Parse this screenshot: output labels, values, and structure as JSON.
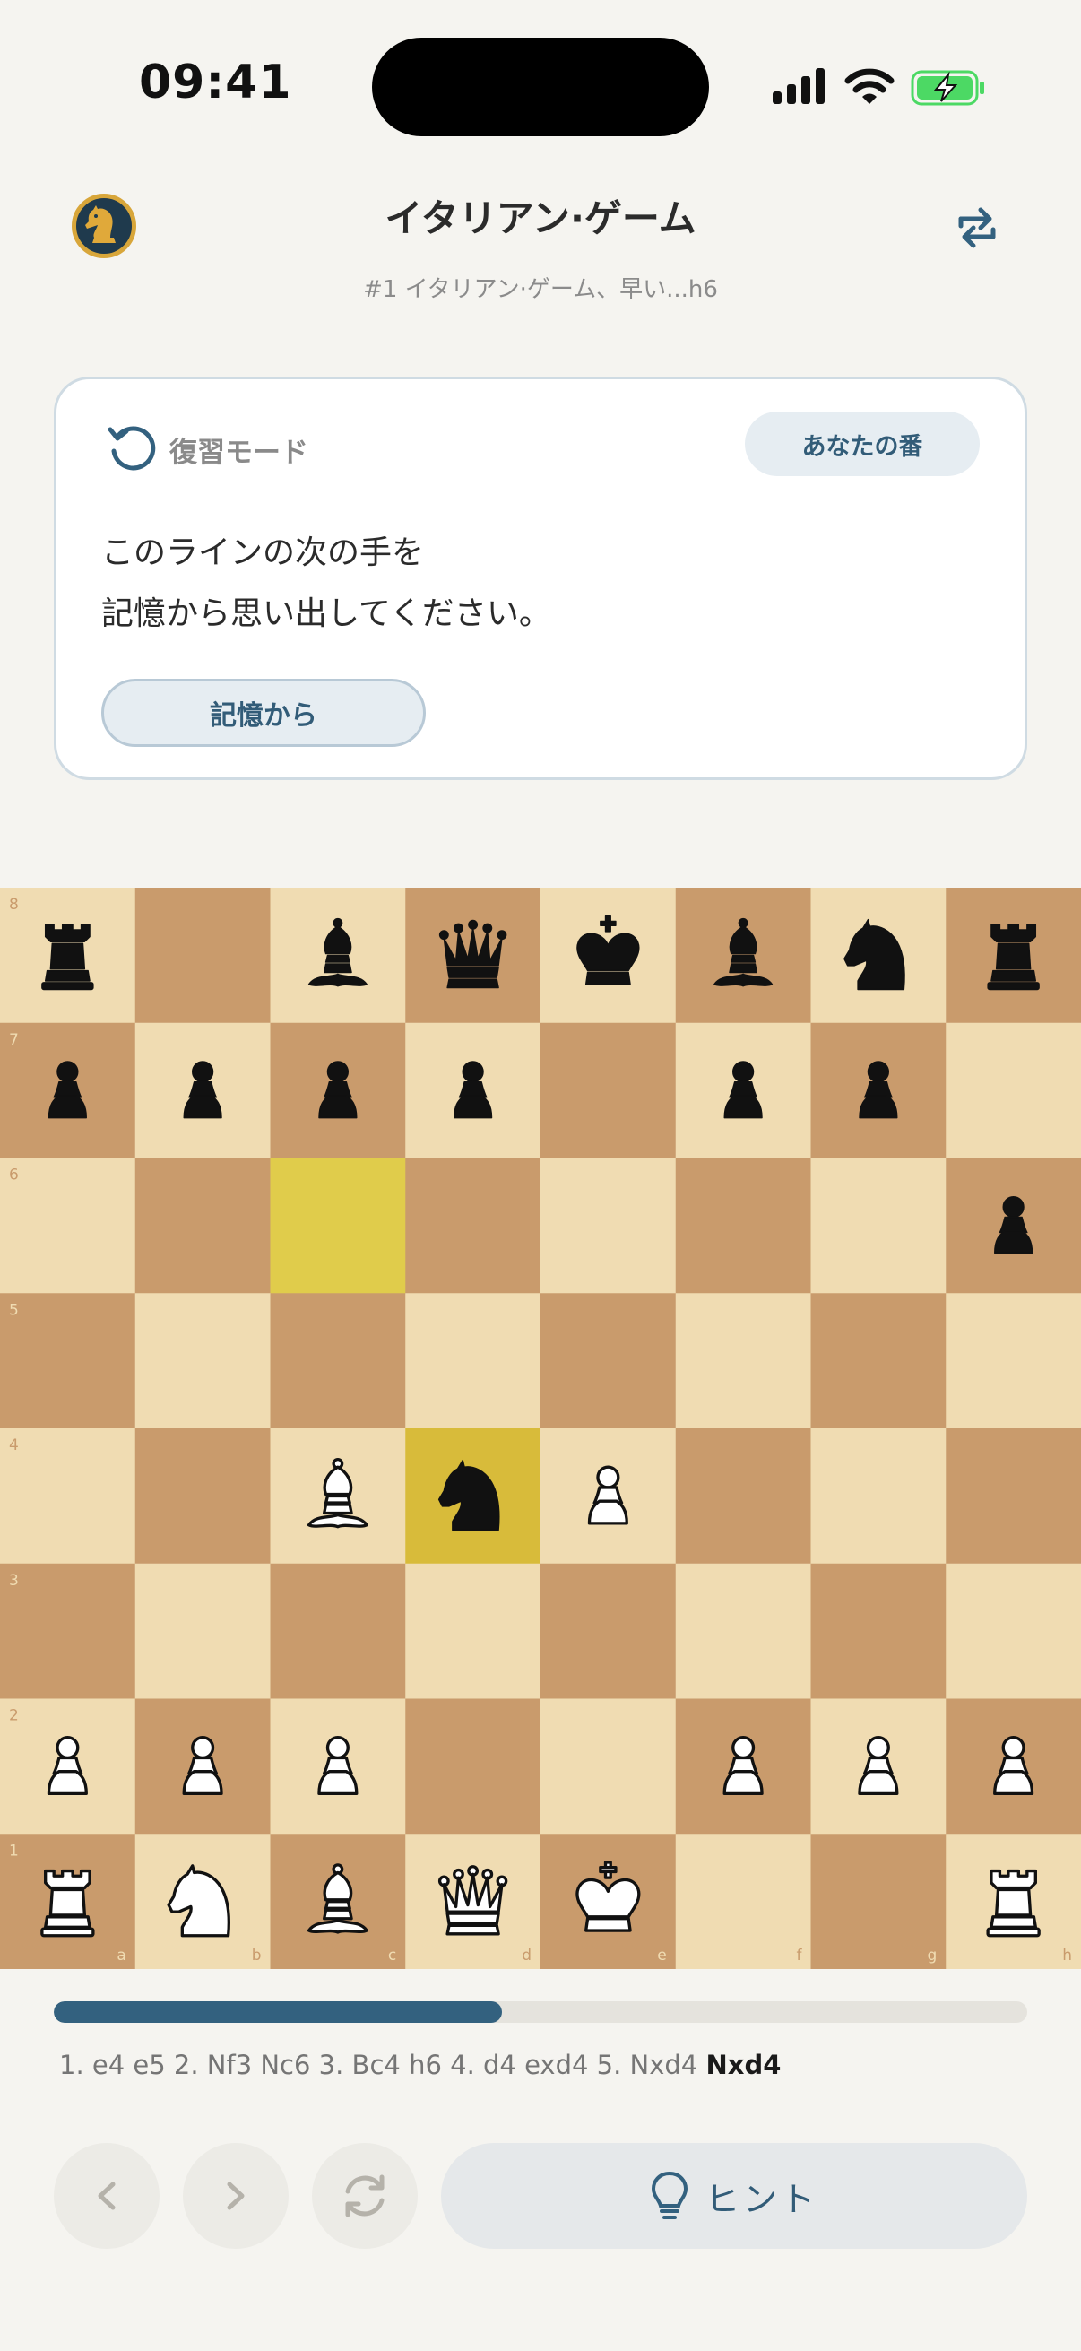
{
  "status_bar": {
    "time": "09:41"
  },
  "header": {
    "title": "イタリアン·ゲーム",
    "subtitle": "#1 イタリアン·ゲーム、早い...h6",
    "logo_icon": "knight-logo-icon",
    "flip_icon": "flip-board-icon"
  },
  "review_card": {
    "mode_label": "復習モード",
    "mode_icon": "undo-circle-icon",
    "turn_badge": "あなたの番",
    "prompt_line1": "このラインの次の手を",
    "prompt_line2": "記憶から思い出してください。",
    "memory_button": "記憶から"
  },
  "board": {
    "orientation": "white",
    "light_color": "#f0dcb2",
    "dark_color": "#c99b6c",
    "highlight_light": "#e0cc4b",
    "highlight_dark": "#d8bb3a",
    "highlights": [
      "c6",
      "d4"
    ],
    "ranks": [
      "8",
      "7",
      "6",
      "5",
      "4",
      "3",
      "2",
      "1"
    ],
    "files": [
      "a",
      "b",
      "c",
      "d",
      "e",
      "f",
      "g",
      "h"
    ],
    "pieces": [
      {
        "sq": "a8",
        "p": "r"
      },
      {
        "sq": "c8",
        "p": "b"
      },
      {
        "sq": "d8",
        "p": "q"
      },
      {
        "sq": "e8",
        "p": "k"
      },
      {
        "sq": "f8",
        "p": "b"
      },
      {
        "sq": "g8",
        "p": "n"
      },
      {
        "sq": "h8",
        "p": "r"
      },
      {
        "sq": "a7",
        "p": "p"
      },
      {
        "sq": "b7",
        "p": "p"
      },
      {
        "sq": "c7",
        "p": "p"
      },
      {
        "sq": "d7",
        "p": "p"
      },
      {
        "sq": "f7",
        "p": "p"
      },
      {
        "sq": "g7",
        "p": "p"
      },
      {
        "sq": "h6",
        "p": "p"
      },
      {
        "sq": "c4",
        "p": "B"
      },
      {
        "sq": "d4",
        "p": "n"
      },
      {
        "sq": "e4",
        "p": "P"
      },
      {
        "sq": "a2",
        "p": "P"
      },
      {
        "sq": "b2",
        "p": "P"
      },
      {
        "sq": "c2",
        "p": "P"
      },
      {
        "sq": "f2",
        "p": "P"
      },
      {
        "sq": "g2",
        "p": "P"
      },
      {
        "sq": "h2",
        "p": "P"
      },
      {
        "sq": "a1",
        "p": "R"
      },
      {
        "sq": "b1",
        "p": "N"
      },
      {
        "sq": "c1",
        "p": "B"
      },
      {
        "sq": "d1",
        "p": "Q"
      },
      {
        "sq": "e1",
        "p": "K"
      },
      {
        "sq": "h1",
        "p": "R"
      }
    ]
  },
  "progress": {
    "fraction": 0.46,
    "fill_color": "#33617f"
  },
  "moves": {
    "played": "1. e4 e5 2. Nf3 Nc6 3. Bc4 h6 4. d4 exd4 5. Nxd4",
    "current": "Nxd4"
  },
  "controls": {
    "prev_icon": "chevron-left-icon",
    "next_icon": "chevron-right-icon",
    "reset_icon": "refresh-icon",
    "hint_icon": "lightbulb-icon",
    "hint_label": "ヒント"
  }
}
